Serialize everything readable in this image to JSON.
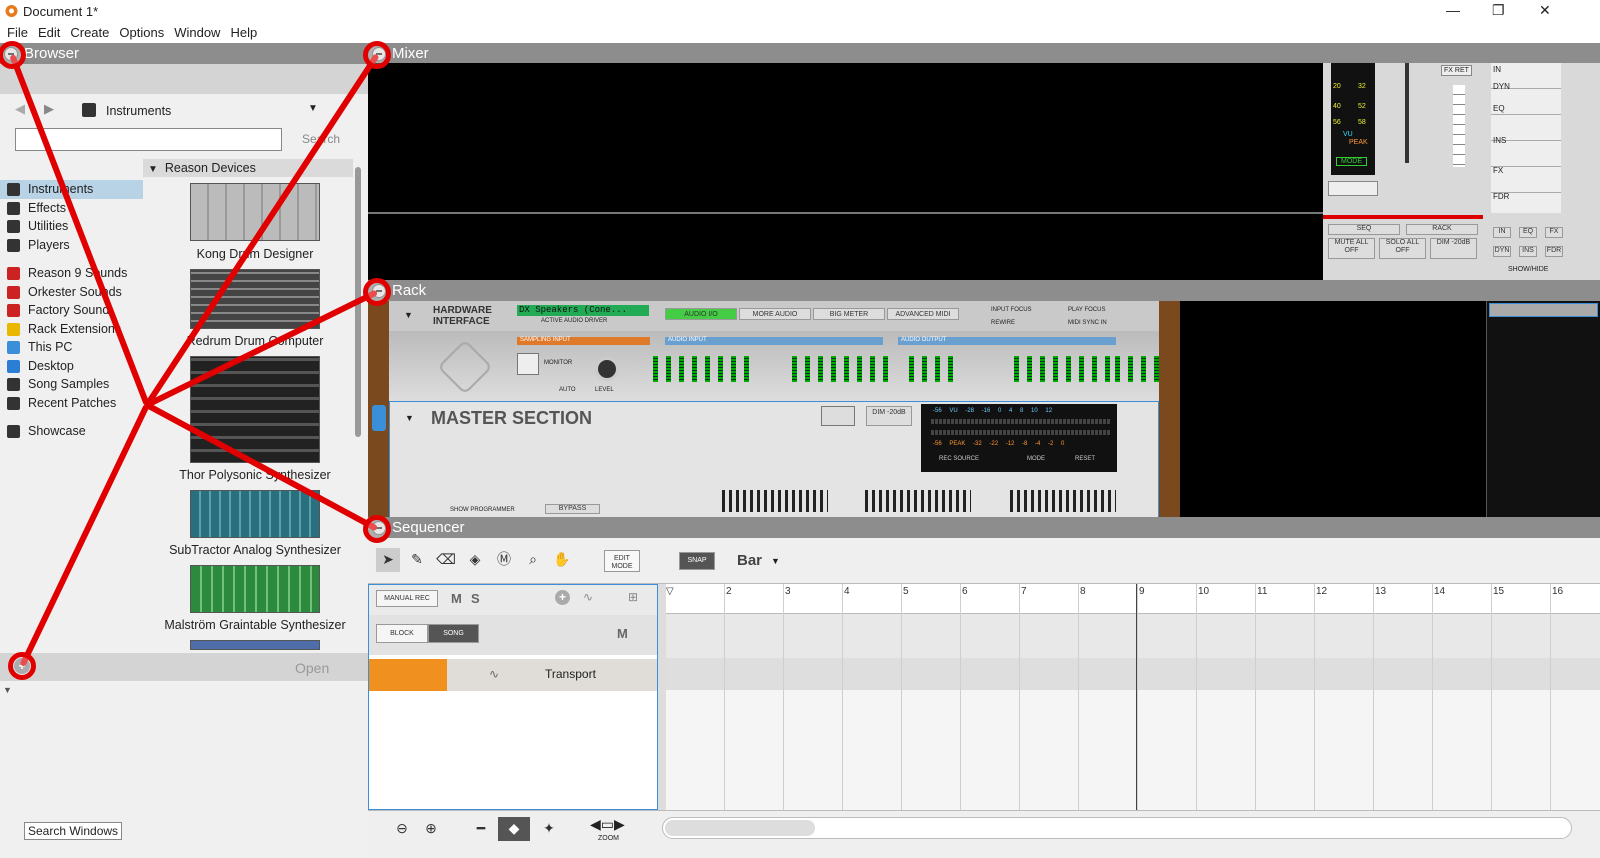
{
  "window": {
    "title": "Document 1*",
    "minimize": "—",
    "restore": "❐",
    "close": "✕"
  },
  "menu": [
    "File",
    "Edit",
    "Create",
    "Options",
    "Window",
    "Help"
  ],
  "browser": {
    "title": "Browser",
    "location": "Instruments",
    "search_value": "",
    "search_label": "Search",
    "locations": [
      "Instruments",
      "Effects",
      "Utilities",
      "Players",
      "Reason 9 Sounds",
      "Orkester Sounds",
      "Factory Sound",
      "Rack Extensions",
      "This PC",
      "Desktop",
      "Song Samples",
      "Recent Patches",
      "Showcase"
    ],
    "devices_header": "Reason Devices",
    "devices": [
      "Kong Drum Designer",
      "Redrum Drum Computer",
      "Thor Polysonic Synthesizer",
      "SubTractor Analog Synthesizer",
      "Malström Graintable Synthesizer"
    ],
    "open_label": "Open",
    "search_windows": "Search Windows"
  },
  "mixer": {
    "title": "Mixer",
    "fx_ret": "FX RET",
    "labels": [
      "IN",
      "DYN",
      "EQ",
      "INS",
      "FX",
      "FDR"
    ],
    "buttons": [
      "SEQ",
      "RACK",
      "MUTE ALL OFF",
      "SOLO ALL OFF",
      "DIM -20dB"
    ],
    "showhide": [
      "IN",
      "EQ",
      "FX",
      "DYN",
      "INS",
      "FDR"
    ],
    "showhide_label": "SHOW/HIDE",
    "vu": "VU",
    "peak": "PEAK",
    "mode": "MODE",
    "vu_scale": [
      "20",
      "32",
      "40",
      "52",
      "56",
      "58"
    ]
  },
  "rack": {
    "title": "Rack",
    "hw_title": "HARDWARE INTERFACE",
    "audio_driver": "DX Speakers (Cone...",
    "active_audio_driver": "ACTIVE AUDIO DRIVER",
    "tabs": [
      "AUDIO I/O",
      "MORE AUDIO",
      "BIG METER",
      "ADVANCED MIDI"
    ],
    "input_focus": "INPUT FOCUS",
    "play_focus": "PLAY FOCUS",
    "rewire": "REWIRE",
    "midi_sync": "MIDI SYNC IN",
    "sampling_input": "SAMPLING INPUT",
    "monitor": "MONITOR",
    "auto": "AUTO",
    "level": "LEVEL",
    "audio_input": "AUDIO INPUT",
    "audio_output": "AUDIO OUTPUT",
    "master_title": "MASTER SECTION",
    "dim": "DIM -20dB",
    "rec_source": "REC SOURCE",
    "mode": "MODE",
    "reset": "RESET",
    "show_programmer": "SHOW PROGRAMMER",
    "bypass": "BYPASS",
    "master_vu": "-56 VU -28 -16 0 4 8 10 12",
    "master_peak": "-56 PEAK -32 -22 -12 -8 -4 -2 0"
  },
  "sequencer": {
    "title": "Sequencer",
    "edit_mode": "EDIT MODE",
    "snap": "SNAP",
    "snap_value": "Bar",
    "manual_rec": "MANUAL REC",
    "m": "M",
    "s": "S",
    "block": "BLOCK",
    "song": "SONG",
    "m2": "M",
    "transport": "Transport",
    "ruler": [
      "2",
      "3",
      "4",
      "5",
      "6",
      "7",
      "8",
      "9",
      "10",
      "11",
      "12",
      "13",
      "14",
      "15",
      "16"
    ],
    "zoom_label": "ZOOM"
  },
  "colors": {
    "annotation": "#e00000",
    "orange": "#f0901e",
    "panel_header": "#8d8d8d"
  }
}
